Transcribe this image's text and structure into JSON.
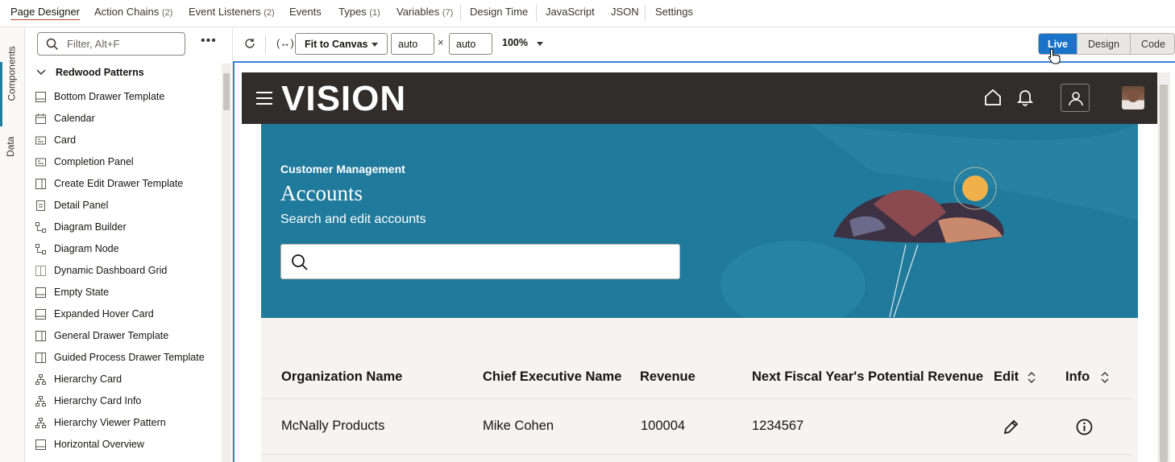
{
  "top_tabs": [
    {
      "label": "Page Designer",
      "count": ""
    },
    {
      "label": "Action Chains",
      "count": "(2)"
    },
    {
      "label": "Event Listeners",
      "count": "(2)"
    },
    {
      "label": "Events",
      "count": ""
    },
    {
      "label": "Types",
      "count": "(1)"
    },
    {
      "label": "Variables",
      "count": "(7)"
    },
    {
      "label": "Design Time",
      "count": ""
    },
    {
      "label": "JavaScript",
      "count": ""
    },
    {
      "label": "JSON",
      "count": ""
    },
    {
      "label": "Settings",
      "count": ""
    }
  ],
  "side_rail": {
    "components": "Components",
    "data": "Data"
  },
  "palette": {
    "filter_placeholder": "Filter, Alt+F",
    "group": "Redwood Patterns",
    "items": [
      {
        "label": "Bottom Drawer Template",
        "icon": "layout-icon"
      },
      {
        "label": "Calendar",
        "icon": "calendar-icon"
      },
      {
        "label": "Card",
        "icon": "card-icon"
      },
      {
        "label": "Completion Panel",
        "icon": "card-icon"
      },
      {
        "label": "Create Edit Drawer Template",
        "icon": "drawer-icon"
      },
      {
        "label": "Detail Panel",
        "icon": "document-icon"
      },
      {
        "label": "Diagram Builder",
        "icon": "diagram-icon"
      },
      {
        "label": "Diagram Node",
        "icon": "diagram-icon"
      },
      {
        "label": "Dynamic Dashboard Grid",
        "icon": "grid-icon"
      },
      {
        "label": "Empty State",
        "icon": "layout-icon"
      },
      {
        "label": "Expanded Hover Card",
        "icon": "layout-icon"
      },
      {
        "label": "General Drawer Template",
        "icon": "drawer-icon"
      },
      {
        "label": "Guided Process Drawer Template",
        "icon": "drawer-icon"
      },
      {
        "label": "Hierarchy Card",
        "icon": "hierarchy-icon"
      },
      {
        "label": "Hierarchy Card Info",
        "icon": "hierarchy-icon"
      },
      {
        "label": "Hierarchy Viewer Pattern",
        "icon": "hierarchy-icon"
      },
      {
        "label": "Horizontal Overview",
        "icon": "layout-icon"
      }
    ]
  },
  "toolbar": {
    "fit_label": "Fit to Canvas",
    "width_value": "auto",
    "height_value": "auto",
    "times": "×",
    "zoom": "100%",
    "modes": [
      "Live",
      "Design",
      "Code"
    ],
    "active_mode": "Live"
  },
  "app": {
    "logo": "VISION",
    "eyebrow": "Customer Management",
    "title": "Accounts",
    "subtitle": "Search and edit accounts",
    "search_placeholder": "",
    "colors": {
      "header": "#312d2a",
      "hero": "#1f7a9c",
      "accent": "#1a73c8"
    },
    "table": {
      "columns": [
        "Organization Name",
        "Chief Executive Name",
        "Revenue",
        "Next Fiscal Year's Potential Revenue",
        "Edit",
        "Info"
      ],
      "rows": [
        {
          "org": "McNally Products",
          "ceo": "Mike Cohen",
          "revenue": "100004",
          "next": "1234567"
        }
      ]
    }
  }
}
